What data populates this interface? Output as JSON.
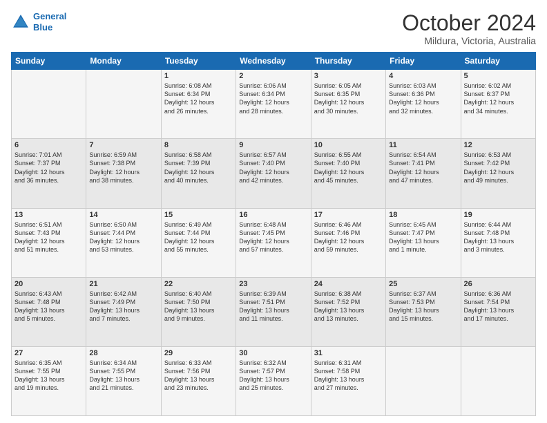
{
  "logo": {
    "line1": "General",
    "line2": "Blue"
  },
  "header": {
    "title": "October 2024",
    "subtitle": "Mildura, Victoria, Australia"
  },
  "weekdays": [
    "Sunday",
    "Monday",
    "Tuesday",
    "Wednesday",
    "Thursday",
    "Friday",
    "Saturday"
  ],
  "weeks": [
    [
      {
        "day": "",
        "info": ""
      },
      {
        "day": "",
        "info": ""
      },
      {
        "day": "1",
        "info": "Sunrise: 6:08 AM\nSunset: 6:34 PM\nDaylight: 12 hours\nand 26 minutes."
      },
      {
        "day": "2",
        "info": "Sunrise: 6:06 AM\nSunset: 6:34 PM\nDaylight: 12 hours\nand 28 minutes."
      },
      {
        "day": "3",
        "info": "Sunrise: 6:05 AM\nSunset: 6:35 PM\nDaylight: 12 hours\nand 30 minutes."
      },
      {
        "day": "4",
        "info": "Sunrise: 6:03 AM\nSunset: 6:36 PM\nDaylight: 12 hours\nand 32 minutes."
      },
      {
        "day": "5",
        "info": "Sunrise: 6:02 AM\nSunset: 6:37 PM\nDaylight: 12 hours\nand 34 minutes."
      }
    ],
    [
      {
        "day": "6",
        "info": "Sunrise: 7:01 AM\nSunset: 7:37 PM\nDaylight: 12 hours\nand 36 minutes."
      },
      {
        "day": "7",
        "info": "Sunrise: 6:59 AM\nSunset: 7:38 PM\nDaylight: 12 hours\nand 38 minutes."
      },
      {
        "day": "8",
        "info": "Sunrise: 6:58 AM\nSunset: 7:39 PM\nDaylight: 12 hours\nand 40 minutes."
      },
      {
        "day": "9",
        "info": "Sunrise: 6:57 AM\nSunset: 7:40 PM\nDaylight: 12 hours\nand 42 minutes."
      },
      {
        "day": "10",
        "info": "Sunrise: 6:55 AM\nSunset: 7:40 PM\nDaylight: 12 hours\nand 45 minutes."
      },
      {
        "day": "11",
        "info": "Sunrise: 6:54 AM\nSunset: 7:41 PM\nDaylight: 12 hours\nand 47 minutes."
      },
      {
        "day": "12",
        "info": "Sunrise: 6:53 AM\nSunset: 7:42 PM\nDaylight: 12 hours\nand 49 minutes."
      }
    ],
    [
      {
        "day": "13",
        "info": "Sunrise: 6:51 AM\nSunset: 7:43 PM\nDaylight: 12 hours\nand 51 minutes."
      },
      {
        "day": "14",
        "info": "Sunrise: 6:50 AM\nSunset: 7:44 PM\nDaylight: 12 hours\nand 53 minutes."
      },
      {
        "day": "15",
        "info": "Sunrise: 6:49 AM\nSunset: 7:44 PM\nDaylight: 12 hours\nand 55 minutes."
      },
      {
        "day": "16",
        "info": "Sunrise: 6:48 AM\nSunset: 7:45 PM\nDaylight: 12 hours\nand 57 minutes."
      },
      {
        "day": "17",
        "info": "Sunrise: 6:46 AM\nSunset: 7:46 PM\nDaylight: 12 hours\nand 59 minutes."
      },
      {
        "day": "18",
        "info": "Sunrise: 6:45 AM\nSunset: 7:47 PM\nDaylight: 13 hours\nand 1 minute."
      },
      {
        "day": "19",
        "info": "Sunrise: 6:44 AM\nSunset: 7:48 PM\nDaylight: 13 hours\nand 3 minutes."
      }
    ],
    [
      {
        "day": "20",
        "info": "Sunrise: 6:43 AM\nSunset: 7:48 PM\nDaylight: 13 hours\nand 5 minutes."
      },
      {
        "day": "21",
        "info": "Sunrise: 6:42 AM\nSunset: 7:49 PM\nDaylight: 13 hours\nand 7 minutes."
      },
      {
        "day": "22",
        "info": "Sunrise: 6:40 AM\nSunset: 7:50 PM\nDaylight: 13 hours\nand 9 minutes."
      },
      {
        "day": "23",
        "info": "Sunrise: 6:39 AM\nSunset: 7:51 PM\nDaylight: 13 hours\nand 11 minutes."
      },
      {
        "day": "24",
        "info": "Sunrise: 6:38 AM\nSunset: 7:52 PM\nDaylight: 13 hours\nand 13 minutes."
      },
      {
        "day": "25",
        "info": "Sunrise: 6:37 AM\nSunset: 7:53 PM\nDaylight: 13 hours\nand 15 minutes."
      },
      {
        "day": "26",
        "info": "Sunrise: 6:36 AM\nSunset: 7:54 PM\nDaylight: 13 hours\nand 17 minutes."
      }
    ],
    [
      {
        "day": "27",
        "info": "Sunrise: 6:35 AM\nSunset: 7:55 PM\nDaylight: 13 hours\nand 19 minutes."
      },
      {
        "day": "28",
        "info": "Sunrise: 6:34 AM\nSunset: 7:55 PM\nDaylight: 13 hours\nand 21 minutes."
      },
      {
        "day": "29",
        "info": "Sunrise: 6:33 AM\nSunset: 7:56 PM\nDaylight: 13 hours\nand 23 minutes."
      },
      {
        "day": "30",
        "info": "Sunrise: 6:32 AM\nSunset: 7:57 PM\nDaylight: 13 hours\nand 25 minutes."
      },
      {
        "day": "31",
        "info": "Sunrise: 6:31 AM\nSunset: 7:58 PM\nDaylight: 13 hours\nand 27 minutes."
      },
      {
        "day": "",
        "info": ""
      },
      {
        "day": "",
        "info": ""
      }
    ]
  ]
}
